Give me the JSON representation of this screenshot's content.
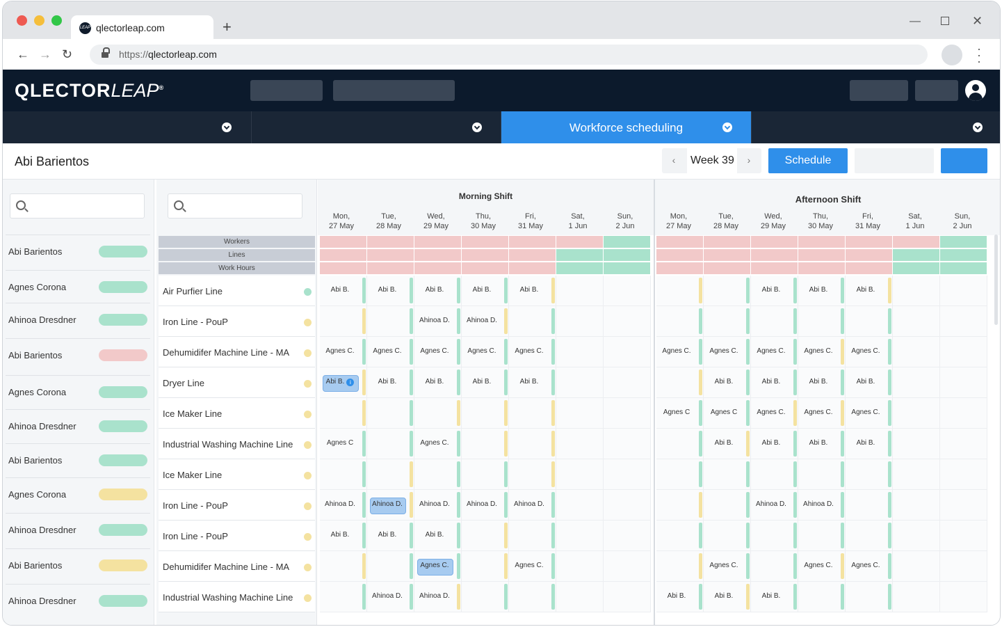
{
  "browser": {
    "tab_title": "qlectorleap.com",
    "favicon_text": "LEAP",
    "url_prefix": "https://",
    "url_host": "qlectorleap.com"
  },
  "app": {
    "logo_main": "QLECTOR",
    "logo_leap": "LEAP",
    "logo_mark": "®"
  },
  "nav": {
    "active_label": "Workforce scheduling"
  },
  "toolbar": {
    "title": "Abi Barientos",
    "week": "Week 39",
    "schedule_label": "Schedule"
  },
  "workers": [
    {
      "name": "Abi Barientos",
      "status": "green"
    },
    {
      "name": "Agnes Corona",
      "status": "green"
    },
    {
      "name": "Ahinoa Dresdner",
      "status": "green"
    },
    {
      "name": "Abi Barientos",
      "status": "red"
    },
    {
      "name": "Agnes Corona",
      "status": "green"
    },
    {
      "name": "Ahinoa Dresdner",
      "status": "green"
    },
    {
      "name": "Abi Barientos",
      "status": "green"
    },
    {
      "name": "Agnes Corona",
      "status": "yellow"
    },
    {
      "name": "Ahinoa Dresdner",
      "status": "green"
    },
    {
      "name": "Abi Barientos",
      "status": "yellow"
    },
    {
      "name": "Ahinoa Dresdner",
      "status": "green"
    }
  ],
  "metrics": [
    "Workers",
    "Lines",
    "Work Hours"
  ],
  "lines": [
    {
      "name": "Air Purfier Line",
      "status": "green"
    },
    {
      "name": "Iron Line - PouP",
      "status": "yellow"
    },
    {
      "name": "Dehumidifer Machine Line - MA",
      "status": "yellow"
    },
    {
      "name": "Dryer Line",
      "status": "yellow"
    },
    {
      "name": "Ice Maker Line",
      "status": "yellow"
    },
    {
      "name": "Industrial Washing Machine Line",
      "status": "yellow"
    },
    {
      "name": "Ice Maker Line",
      "status": "yellow"
    },
    {
      "name": "Iron Line - PouP",
      "status": "yellow"
    },
    {
      "name": "Iron Line - PouP",
      "status": "yellow"
    },
    {
      "name": "Dehumidifer Machine Line - MA",
      "status": "yellow"
    },
    {
      "name": "Industrial Washing Machine Line",
      "status": "yellow"
    }
  ],
  "shifts": [
    {
      "title": "Morning Shift",
      "days": [
        [
          "Mon,",
          "27 May"
        ],
        [
          "Tue,",
          "28 May"
        ],
        [
          "Wed,",
          "29 May"
        ],
        [
          "Thu,",
          "30 May"
        ],
        [
          "Fri,",
          "31 May"
        ],
        [
          "Sat,",
          "1 Jun"
        ],
        [
          "Sun,",
          "2 Jun"
        ]
      ]
    },
    {
      "title": "Afternoon Shift",
      "days": [
        [
          "Mon,",
          "27 May"
        ],
        [
          "Tue,",
          "28 May"
        ],
        [
          "Wed,",
          "29 May"
        ],
        [
          "Thu,",
          "30 May"
        ],
        [
          "Fri,",
          "31 May"
        ],
        [
          "Sat,",
          "1 Jun"
        ],
        [
          "Sun,",
          "2 Jun"
        ]
      ]
    }
  ],
  "metric_colors": [
    [
      "r",
      "r",
      "r",
      "r",
      "r",
      "r",
      "g",
      "r",
      "r",
      "r",
      "r",
      "r",
      "r",
      "g"
    ],
    [
      "r",
      "r",
      "r",
      "r",
      "r",
      "g",
      "g",
      "r",
      "r",
      "r",
      "r",
      "r",
      "g",
      "g"
    ],
    [
      "r",
      "r",
      "r",
      "r",
      "r",
      "g",
      "g",
      "r",
      "r",
      "r",
      "r",
      "r",
      "g",
      "g"
    ]
  ],
  "grid": [
    [
      [
        "Abi B.",
        "g"
      ],
      [
        "Abi B.",
        "g"
      ],
      [
        "Abi B.",
        "g"
      ],
      [
        "Abi B.",
        "g"
      ],
      [
        "Abi B.",
        "y"
      ],
      [
        "",
        ""
      ],
      [
        "",
        ""
      ],
      [
        "",
        "y"
      ],
      [
        "",
        "g"
      ],
      [
        "Abi B.",
        "g"
      ],
      [
        "Abi B.",
        "g"
      ],
      [
        "Abi B.",
        "y"
      ],
      [
        "",
        ""
      ],
      [
        "",
        ""
      ]
    ],
    [
      [
        "",
        "y"
      ],
      [
        "",
        "g"
      ],
      [
        "Ahinoa D.",
        "g"
      ],
      [
        "Ahinoa D.",
        "y"
      ],
      [
        "",
        "g"
      ],
      [
        "",
        ""
      ],
      [
        "",
        ""
      ],
      [
        "",
        "g"
      ],
      [
        "",
        "g"
      ],
      [
        "",
        "g"
      ],
      [
        "",
        "g"
      ],
      [
        "",
        "g"
      ],
      [
        "",
        ""
      ],
      [
        "",
        ""
      ]
    ],
    [
      [
        "Agnes C.",
        "g"
      ],
      [
        "Agnes C.",
        "g"
      ],
      [
        "Agnes C.",
        "g"
      ],
      [
        "Agnes C.",
        "g"
      ],
      [
        "Agnes C.",
        "g"
      ],
      [
        "",
        ""
      ],
      [
        "",
        ""
      ],
      [
        "Agnes C.",
        "g"
      ],
      [
        "Agnes C.",
        "g"
      ],
      [
        "Agnes C.",
        "g"
      ],
      [
        "Agnes C.",
        "y"
      ],
      [
        "Agnes C.",
        "g"
      ],
      [
        "",
        ""
      ],
      [
        "",
        ""
      ]
    ],
    [
      [
        "Abi B.",
        "y",
        "info"
      ],
      [
        "Abi B.",
        "g"
      ],
      [
        "Abi B.",
        "g"
      ],
      [
        "Abi B.",
        "g"
      ],
      [
        "Abi B.",
        "g"
      ],
      [
        "",
        ""
      ],
      [
        "",
        ""
      ],
      [
        "",
        "y"
      ],
      [
        "Abi B.",
        "g"
      ],
      [
        "Abi B.",
        "g"
      ],
      [
        "Abi B.",
        "g"
      ],
      [
        "Abi B.",
        "g"
      ],
      [
        "",
        ""
      ],
      [
        "",
        ""
      ]
    ],
    [
      [
        "",
        "y"
      ],
      [
        "",
        "g"
      ],
      [
        "",
        "y"
      ],
      [
        "",
        "y"
      ],
      [
        "",
        "y"
      ],
      [
        "",
        ""
      ],
      [
        "",
        ""
      ],
      [
        "Agnes C",
        "g"
      ],
      [
        "Agnes C",
        "g"
      ],
      [
        "Agnes C.",
        "y"
      ],
      [
        "Agnes C.",
        "y"
      ],
      [
        "Agnes C.",
        "g"
      ],
      [
        "",
        ""
      ],
      [
        "",
        ""
      ]
    ],
    [
      [
        "Agnes C",
        "g"
      ],
      [
        "",
        "g"
      ],
      [
        "Agnes C.",
        "g"
      ],
      [
        "",
        "y"
      ],
      [
        "",
        "y"
      ],
      [
        "",
        ""
      ],
      [
        "",
        ""
      ],
      [
        "",
        "g"
      ],
      [
        "Abi B.",
        "y"
      ],
      [
        "Abi B.",
        "g"
      ],
      [
        "Abi B.",
        "g"
      ],
      [
        "Abi B.",
        "g"
      ],
      [
        "",
        ""
      ],
      [
        "",
        ""
      ]
    ],
    [
      [
        "",
        "g"
      ],
      [
        "",
        "y"
      ],
      [
        "",
        "g"
      ],
      [
        "",
        "g"
      ],
      [
        "",
        "y"
      ],
      [
        "",
        ""
      ],
      [
        "",
        ""
      ],
      [
        "",
        "g"
      ],
      [
        "",
        "g"
      ],
      [
        "",
        "g"
      ],
      [
        "",
        "g"
      ],
      [
        "",
        "g"
      ],
      [
        "",
        ""
      ],
      [
        "",
        ""
      ]
    ],
    [
      [
        "Ahinoa D.",
        "g"
      ],
      [
        "Ahinoa D.",
        "y",
        "hl"
      ],
      [
        "Ahinoa D.",
        "g"
      ],
      [
        "Ahinoa D.",
        "g"
      ],
      [
        "Ahinoa D.",
        "g"
      ],
      [
        "",
        ""
      ],
      [
        "",
        ""
      ],
      [
        "",
        "y"
      ],
      [
        "",
        "g"
      ],
      [
        "Ahinoa D.",
        "g"
      ],
      [
        "Ahinoa D.",
        "g"
      ],
      [
        "",
        "g"
      ],
      [
        "",
        ""
      ],
      [
        "",
        ""
      ]
    ],
    [
      [
        "Abi B.",
        "g"
      ],
      [
        "Abi B.",
        "g"
      ],
      [
        "Abi B.",
        "g"
      ],
      [
        "",
        "y"
      ],
      [
        "",
        "g"
      ],
      [
        "",
        ""
      ],
      [
        "",
        ""
      ],
      [
        "",
        "g"
      ],
      [
        "",
        "g"
      ],
      [
        "",
        "g"
      ],
      [
        "",
        "g"
      ],
      [
        "",
        "g"
      ],
      [
        "",
        ""
      ],
      [
        "",
        ""
      ]
    ],
    [
      [
        "",
        "y"
      ],
      [
        "",
        "g"
      ],
      [
        "Agnes C.",
        "g",
        "hl"
      ],
      [
        "",
        "y"
      ],
      [
        "Agnes C.",
        "g"
      ],
      [
        "",
        ""
      ],
      [
        "",
        ""
      ],
      [
        "",
        "y"
      ],
      [
        "Agnes C.",
        "g"
      ],
      [
        "",
        "g"
      ],
      [
        "Agnes C.",
        "y"
      ],
      [
        "Agnes C.",
        "g"
      ],
      [
        "",
        ""
      ],
      [
        "",
        ""
      ]
    ],
    [
      [
        "",
        "g"
      ],
      [
        "Ahinoa D.",
        "g"
      ],
      [
        "Ahinoa D.",
        "y"
      ],
      [
        "",
        "g"
      ],
      [
        "",
        "g"
      ],
      [
        "",
        ""
      ],
      [
        "",
        ""
      ],
      [
        "Abi B.",
        "g"
      ],
      [
        "Abi B.",
        "y"
      ],
      [
        "Abi B.",
        "g"
      ],
      [
        "",
        "g"
      ],
      [
        "",
        "g"
      ],
      [
        "",
        ""
      ],
      [
        "",
        ""
      ]
    ]
  ],
  "colors": {
    "green": "#a9e2cc",
    "yellow": "#f4e2a0",
    "red": "#f2c9c9",
    "accent": "#2f8fea",
    "header": "#0c1a2c"
  }
}
